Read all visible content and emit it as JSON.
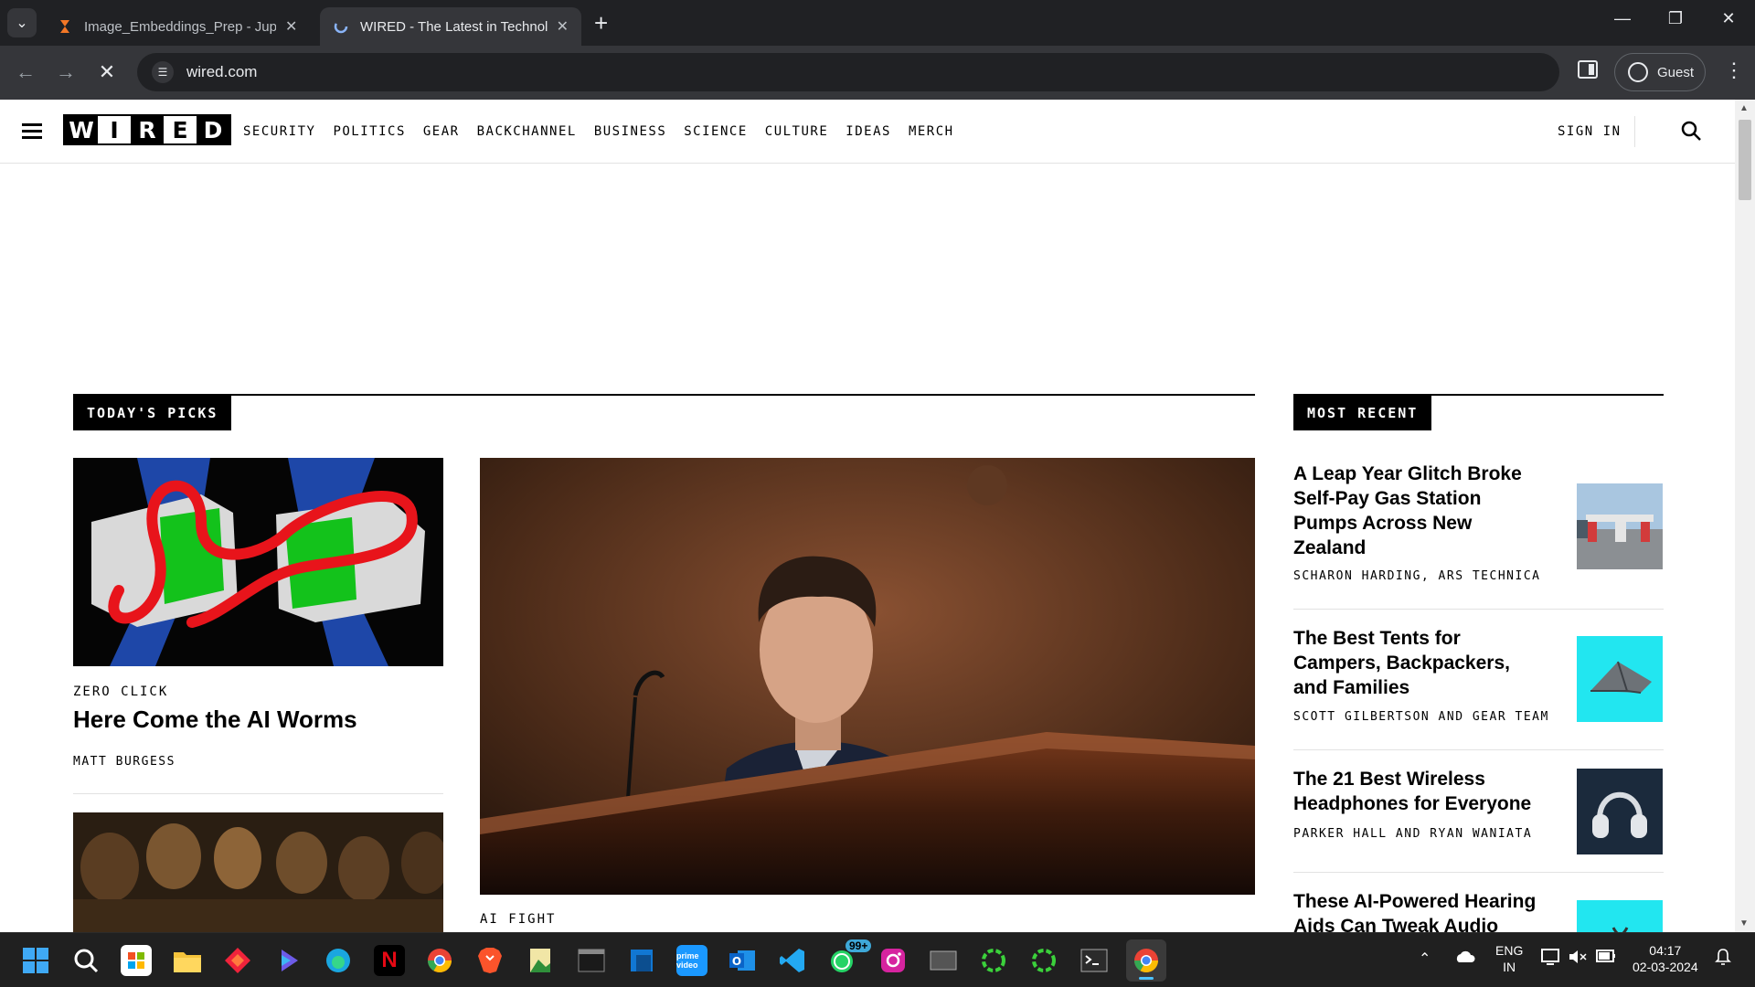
{
  "browser": {
    "tabs": [
      {
        "title": "Image_Embeddings_Prep - Jupy"
      },
      {
        "title": "WIRED - The Latest in Technolo"
      }
    ],
    "url": "wired.com",
    "profile_label": "Guest"
  },
  "header": {
    "logo_letters": [
      "W",
      "I",
      "R",
      "E",
      "D"
    ],
    "nav": [
      "SECURITY",
      "POLITICS",
      "GEAR",
      "BACKCHANNEL",
      "BUSINESS",
      "SCIENCE",
      "CULTURE",
      "IDEAS",
      "MERCH"
    ],
    "sign_in": "SIGN IN"
  },
  "todays_picks": {
    "label": "TODAY'S PICKS",
    "cards": [
      {
        "rubric": "ZERO CLICK",
        "headline": "Here Come the AI Worms",
        "byline": "MATT BURGESS"
      }
    ],
    "lead": {
      "rubric": "AI FIGHT"
    }
  },
  "most_recent": {
    "label": "MOST RECENT",
    "items": [
      {
        "headline": "A Leap Year Glitch Broke Self-Pay Gas Station Pumps Across New Zealand",
        "byline": "SCHARON HARDING, ARS TECHNICA",
        "thumb": "gas-station-photo"
      },
      {
        "headline": "The Best Tents for Campers, Backpackers, and Families",
        "byline": "SCOTT GILBERTSON AND GEAR TEAM",
        "thumb": "tent-photo"
      },
      {
        "headline": "The 21 Best Wireless Headphones for Everyone",
        "byline": "PARKER HALL AND RYAN WANIATA",
        "thumb": "headphones-photo"
      },
      {
        "headline": "These AI-Powered Hearing Aids Can Tweak Audio",
        "byline": "",
        "thumb": "hearing-aids-photo"
      }
    ]
  },
  "taskbar": {
    "apps": [
      "start",
      "search",
      "store",
      "file-explorer",
      "app-red",
      "copilot",
      "edge",
      "netflix",
      "chrome",
      "brave",
      "photos",
      "terminal",
      "app-blue",
      "prime-video",
      "outlook",
      "vscode",
      "whatsapp",
      "instagram",
      "app-gray",
      "ring-green",
      "ring-green-2",
      "terminal-2",
      "chrome-active"
    ],
    "prime_label": "prime video",
    "whatsapp_badge": "99+",
    "language": "ENG",
    "region": "IN",
    "time": "04:17",
    "date": "02-03-2024"
  }
}
